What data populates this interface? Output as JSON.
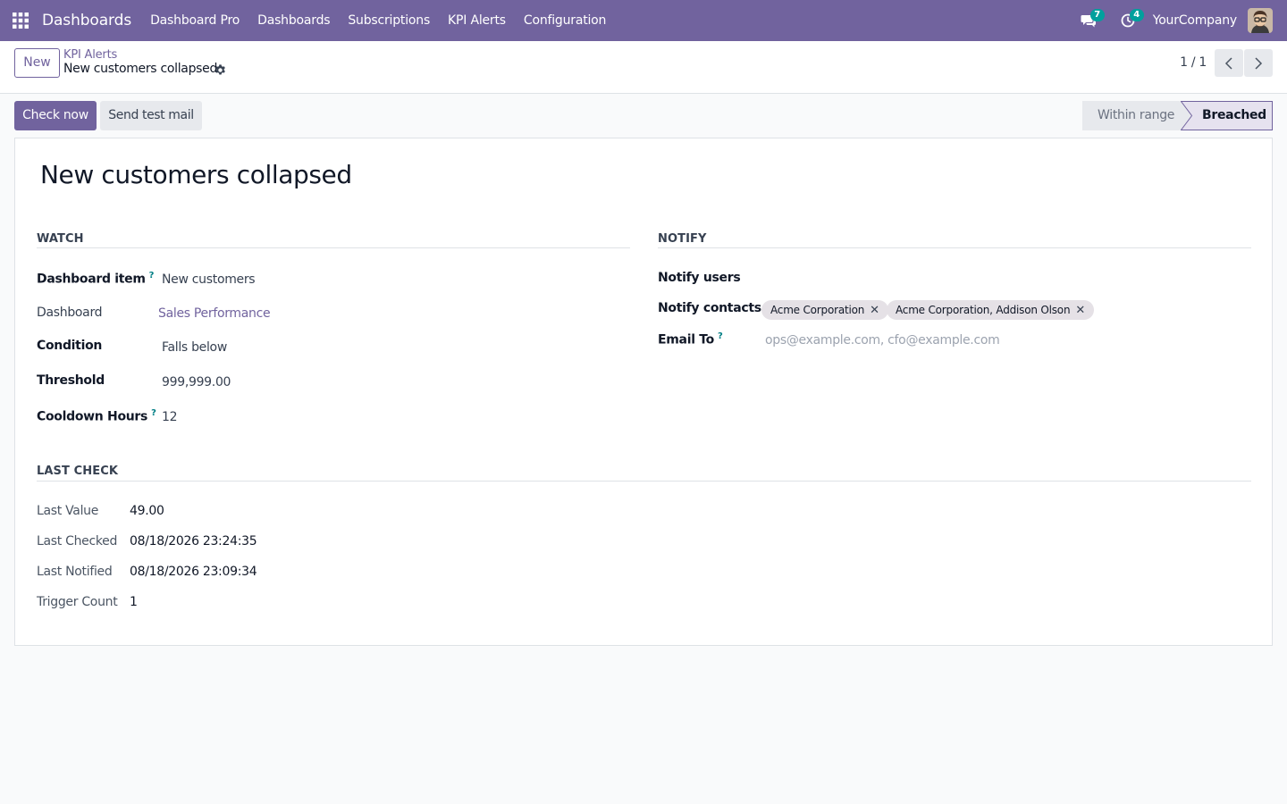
{
  "navbar": {
    "app_name": "Dashboards",
    "menu": [
      "Dashboard Pro",
      "Dashboards",
      "Subscriptions",
      "KPI Alerts",
      "Configuration"
    ],
    "messages_count": "7",
    "activities_count": "4",
    "company": "YourCompany",
    "color": "#71639e"
  },
  "control_panel": {
    "new_label": "New",
    "breadcrumb_parent": "KPI Alerts",
    "breadcrumb_current": "New customers collapsed",
    "pager": "1 / 1"
  },
  "statusbar": {
    "check_now": "Check now",
    "send_test_mail": "Send test mail",
    "stages": [
      "Within range",
      "Breached"
    ],
    "active_stage": "Breached"
  },
  "form": {
    "title": "New customers collapsed",
    "watch": {
      "section": "Watch",
      "dashboard_item_label": "Dashboard item",
      "dashboard_item_value": "New customers",
      "dashboard_label": "Dashboard",
      "dashboard_value": "Sales Performance",
      "condition_label": "Condition",
      "condition_value": "Falls below",
      "threshold_label": "Threshold",
      "threshold_value": "999,999.00",
      "cooldown_label": "Cooldown Hours",
      "cooldown_value": "12"
    },
    "notify": {
      "section": "Notify",
      "users_label": "Notify users",
      "contacts_label": "Notify contacts",
      "contacts": [
        "Acme Corporation",
        "Acme Corporation, Addison Olson"
      ],
      "email_label": "Email To",
      "email_placeholder": "ops@example.com, cfo@example.com"
    },
    "last_check": {
      "section": "Last Check",
      "last_value_label": "Last Value",
      "last_value": "49.00",
      "last_checked_label": "Last Checked",
      "last_checked": "08/18/2026 23:24:35",
      "last_notified_label": "Last Notified",
      "last_notified": "08/18/2026 23:09:34",
      "trigger_count_label": "Trigger Count",
      "trigger_count": "1"
    },
    "help_glyph": "?"
  }
}
